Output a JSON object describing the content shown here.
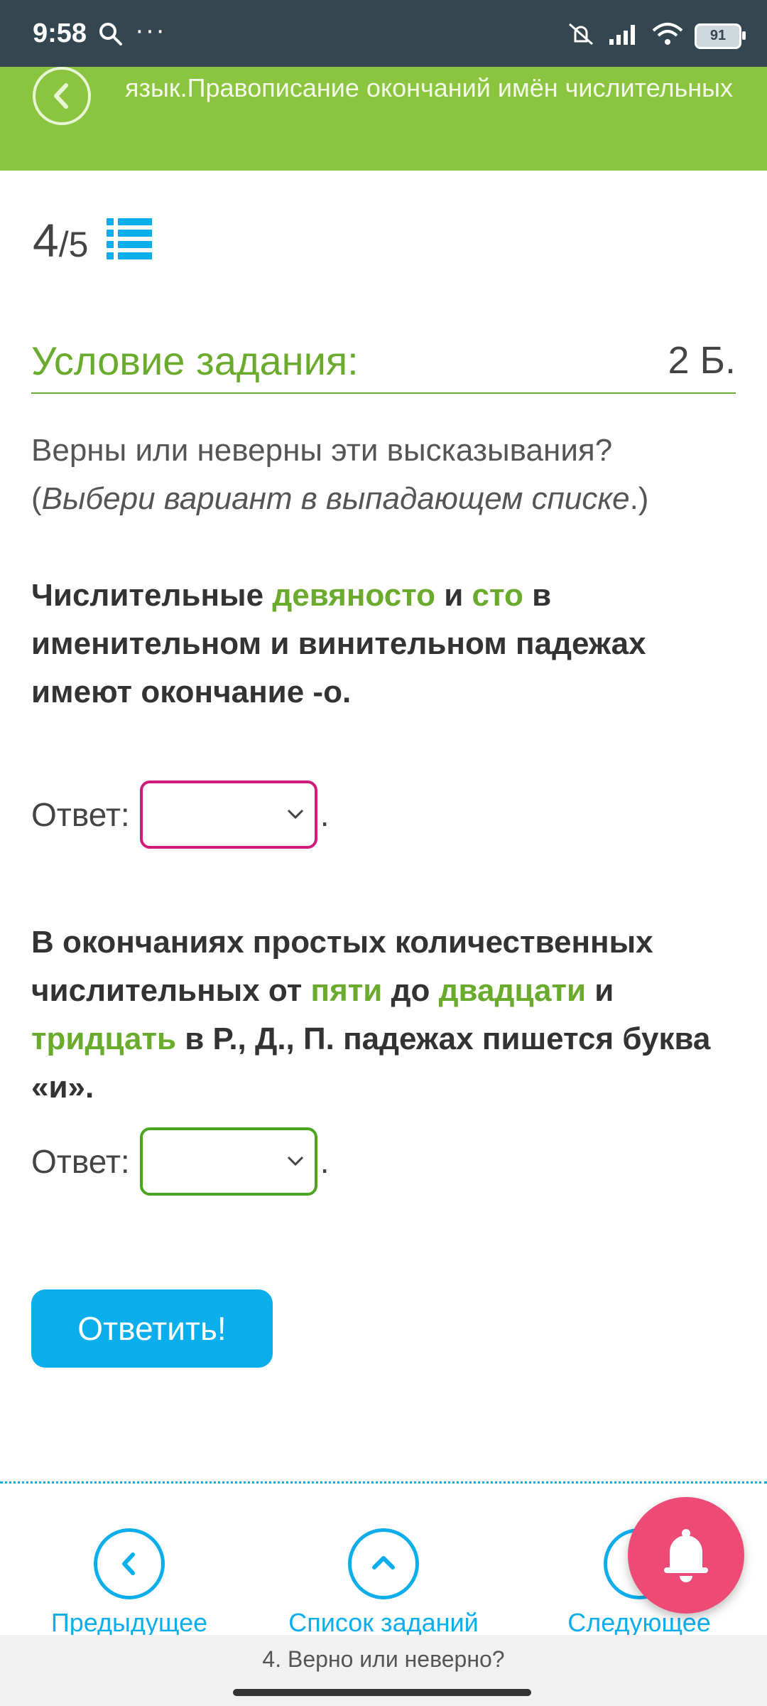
{
  "status": {
    "time": "9:58",
    "more": "···",
    "battery": "91"
  },
  "header": {
    "title": "язык.Правописание окончаний имён числительных"
  },
  "progress": {
    "current": "4",
    "total": "/5"
  },
  "condition": {
    "title": "Условие задания:",
    "points": "2 Б."
  },
  "intro": {
    "text": "Верны или неверны эти высказывания? (",
    "hint": "Выбери вариант в выпадающем списке",
    "tail": ".)"
  },
  "q1": {
    "t1": "Числительные ",
    "g1": "девяносто",
    "t2": " и ",
    "g2": "сто",
    "t3": " в именительном и винительном падежах имеют окончание -о."
  },
  "q2": {
    "t1": "В окончаниях простых количественных числительных от ",
    "g1": "пяти",
    "t2": " до ",
    "g2": "двадцати",
    "t3": " и ",
    "g3": "тридцать",
    "t4": " в Р., Д., П. падежах пишется буква «и»."
  },
  "answers": {
    "label": "Ответ:",
    "dot": "."
  },
  "submit": {
    "label": "Ответить!"
  },
  "nav": {
    "prev": "Предыдущее",
    "list": "Список заданий",
    "next": "Следующее"
  },
  "footer": {
    "text": "4. Верно или неверно?"
  },
  "colors": {
    "header_green": "#8bc53f",
    "accent_blue": "#0aaeec",
    "bell_pink": "#ee4a76",
    "select1_border": "#d01b7c",
    "select2_border": "#4aa51f"
  }
}
